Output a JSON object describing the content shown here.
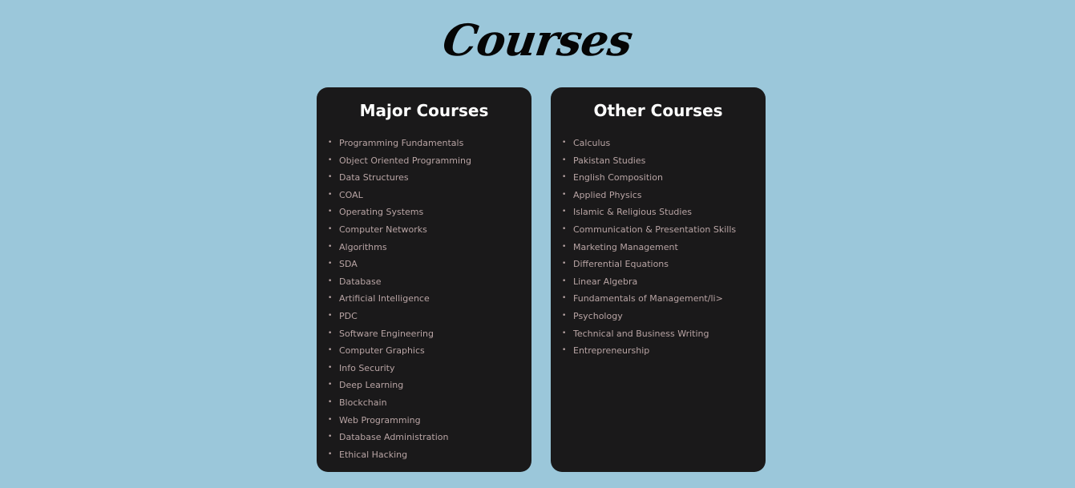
{
  "page": {
    "title": "Courses"
  },
  "major": {
    "title": "Major Courses",
    "items": [
      "Programming Fundamentals",
      "Object Oriented Programming",
      "Data Structures",
      "COAL",
      "Operating Systems",
      "Computer Networks",
      "Algorithms",
      "SDA",
      "Database",
      "Artificial Intelligence",
      "PDC",
      "Software Engineering",
      "Computer Graphics",
      "Info Security",
      "Deep Learning",
      "Blockchain",
      "Web Programming",
      "Database Administration",
      "Ethical Hacking"
    ]
  },
  "other": {
    "title": "Other Courses",
    "items": [
      "Calculus",
      "Pakistan Studies",
      "English Composition",
      "Applied Physics",
      "Islamic & Religious Studies",
      "Communication & Presentation Skills",
      "Marketing Management",
      "Differential Equations",
      "Linear Algebra",
      "Fundamentals of Management/li>",
      "Psychology",
      "Technical and Business Writing",
      "Entrepreneurship"
    ]
  },
  "colors": {
    "background": "#9bc7da",
    "card": "#1a191a",
    "card_title": "#ffffff",
    "item_text": "#b8a4a4"
  }
}
